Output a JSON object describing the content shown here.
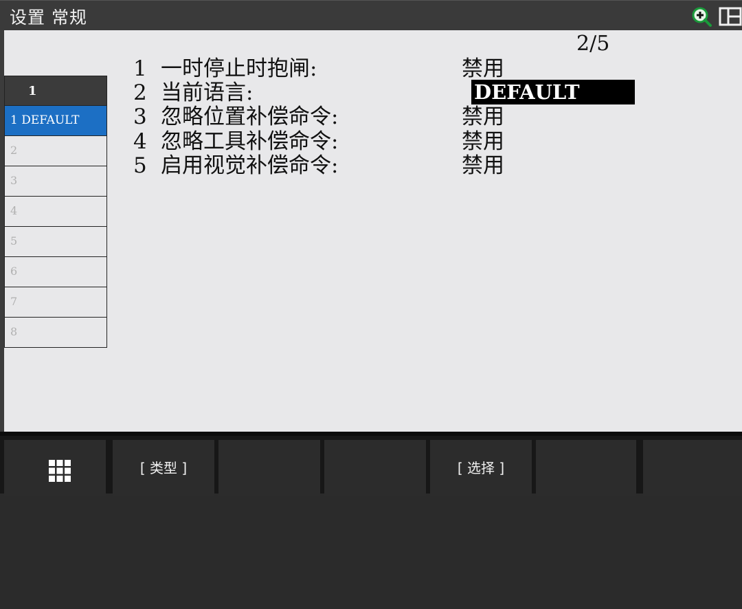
{
  "window": {
    "title": "设置 常规"
  },
  "icons": {
    "zoom": "zoom-in-icon",
    "layout": "split-layout-icon",
    "menu": "grid-menu-icon"
  },
  "sidebar": {
    "header": "1",
    "items": [
      {
        "label": "1 DEFAULT",
        "selected": true
      },
      {
        "label": "2"
      },
      {
        "label": "3"
      },
      {
        "label": "4"
      },
      {
        "label": "5"
      },
      {
        "label": "6"
      },
      {
        "label": "7"
      },
      {
        "label": "8"
      }
    ]
  },
  "page_indicator": "2/5",
  "settings": [
    {
      "num": "1",
      "label": "一时停止时抱闸:",
      "value": "禁用"
    },
    {
      "num": "2",
      "label": "当前语言:",
      "value": "DEFAULT"
    },
    {
      "num": "3",
      "label": "忽略位置补偿命令:",
      "value": "禁用"
    },
    {
      "num": "4",
      "label": "忽略工具补偿命令:",
      "value": "禁用"
    },
    {
      "num": "5",
      "label": "启用视觉补偿命令:",
      "value": "禁用"
    }
  ],
  "function_keys": [
    {
      "label": ""
    },
    {
      "label": "[ 类型 ]"
    },
    {
      "label": ""
    },
    {
      "label": ""
    },
    {
      "label": "[ 选择 ]"
    },
    {
      "label": ""
    },
    {
      "label": ""
    }
  ],
  "colors": {
    "selected_row": "#1c6fc4",
    "value_highlight": "#000000",
    "title_bar": "#3a3a3a",
    "content_bg": "#e8e8ea",
    "zoom_icon": "#1a9a3a"
  }
}
